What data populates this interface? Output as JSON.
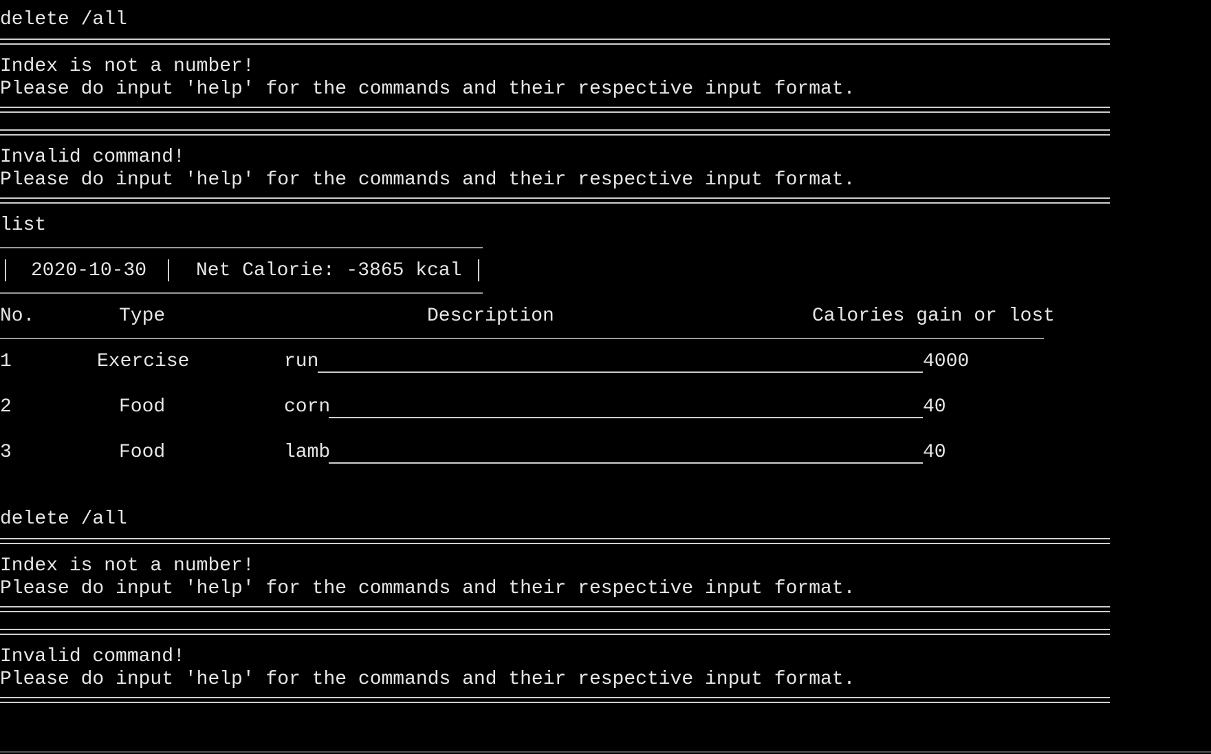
{
  "terminal": {
    "block1": {
      "command": "delete /all",
      "error": "Index is not a number!",
      "hint": "Please do input 'help' for the commands and their respective input format."
    },
    "block2": {
      "error": "Invalid command!",
      "hint": "Please do input 'help' for the commands and their respective input format."
    },
    "list_command": "list",
    "summary": {
      "date": "2020-10-30",
      "net_calorie": "Net Calorie: -3865 kcal"
    },
    "table": {
      "headers": {
        "no": "No.",
        "type": "Type",
        "description": "Description",
        "calories": "Calories gain or lost"
      },
      "rows": [
        {
          "no": "1",
          "type": "Exercise",
          "description": "run",
          "calories": "4000"
        },
        {
          "no": "2",
          "type": "Food",
          "description": "corn",
          "calories": "40"
        },
        {
          "no": "3",
          "type": "Food",
          "description": "lamb",
          "calories": "40"
        }
      ]
    },
    "block3": {
      "command": "delete /all",
      "error": "Index is not a number!",
      "hint": "Please do input 'help' for the commands and their respective input format."
    },
    "block4": {
      "error": "Invalid command!",
      "hint": "Please do input 'help' for the commands and their respective input format."
    }
  }
}
